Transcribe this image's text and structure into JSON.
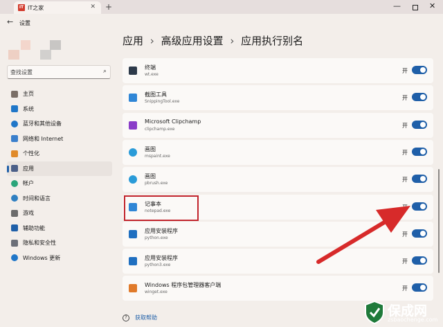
{
  "browser": {
    "tab_title": "IT之家",
    "favicon_text": "IT",
    "close_glyph": "✕",
    "new_tab_glyph": "+",
    "minimize_glyph": "—",
    "win_close_glyph": "✕"
  },
  "app": {
    "title": "设置",
    "back_glyph": "←"
  },
  "search": {
    "placeholder": "查找设置",
    "icon": "search-icon"
  },
  "sidebar": {
    "items": [
      {
        "label": "主页",
        "icon": "home-icon",
        "color": "#7a6e66",
        "active": false
      },
      {
        "label": "系统",
        "icon": "monitor-icon",
        "color": "#1f76c8",
        "active": false
      },
      {
        "label": "蓝牙和其他设备",
        "icon": "bluetooth-icon",
        "color": "#1f76c8",
        "active": false
      },
      {
        "label": "网络和 Internet",
        "icon": "wifi-icon",
        "color": "#3a7fcc",
        "active": false
      },
      {
        "label": "个性化",
        "icon": "brush-icon",
        "color": "#e08a2a",
        "active": false
      },
      {
        "label": "应用",
        "icon": "apps-icon",
        "color": "#4b5f88",
        "active": true
      },
      {
        "label": "帐户",
        "icon": "person-icon",
        "color": "#2aa57a",
        "active": false
      },
      {
        "label": "时间和语言",
        "icon": "clock-globe-icon",
        "color": "#2f7fc1",
        "active": false
      },
      {
        "label": "游戏",
        "icon": "gamepad-icon",
        "color": "#6b6b6b",
        "active": false
      },
      {
        "label": "辅助功能",
        "icon": "accessibility-icon",
        "color": "#1f5fa8",
        "active": false
      },
      {
        "label": "隐私和安全性",
        "icon": "shield-icon",
        "color": "#6b6f78",
        "active": false
      },
      {
        "label": "Windows 更新",
        "icon": "update-icon",
        "color": "#1f76c8",
        "active": false
      }
    ]
  },
  "breadcrumb": {
    "part1": "应用",
    "part2": "高级应用设置",
    "part3": "应用执行别名",
    "sep": "›"
  },
  "aliases": [
    {
      "name": "终端",
      "exe": "wt.exe",
      "state": "开",
      "icon": "terminal-icon",
      "color": "#2d3a4a"
    },
    {
      "name": "截图工具",
      "exe": "SnippingTool.exe",
      "state": "开",
      "icon": "snipping-tool-icon",
      "color": "#2f86d6"
    },
    {
      "name": "Microsoft Clipchamp",
      "exe": "clipchamp.exe",
      "state": "开",
      "icon": "clipchamp-icon",
      "color": "#8a3cc8"
    },
    {
      "name": "画图",
      "exe": "mspaint.exe",
      "state": "开",
      "icon": "paint-icon",
      "color": "#2a9bd8"
    },
    {
      "name": "画图",
      "exe": "pbrush.exe",
      "state": "开",
      "icon": "paint-icon",
      "color": "#2a9bd8"
    },
    {
      "name": "记事本",
      "exe": "notepad.exe",
      "state": "开",
      "icon": "notepad-icon",
      "color": "#2f86d6"
    },
    {
      "name": "应用安装程序",
      "exe": "python.exe",
      "state": "开",
      "icon": "app-installer-icon",
      "color": "#1f6fc0"
    },
    {
      "name": "应用安装程序",
      "exe": "python3.exe",
      "state": "开",
      "icon": "app-installer-icon",
      "color": "#1f6fc0"
    },
    {
      "name": "Windows 程序包管理器客户端",
      "exe": "winget.exe",
      "state": "开",
      "icon": "package-manager-icon",
      "color": "#e07a2a"
    }
  ],
  "help": {
    "label": "获取帮助",
    "icon": "help-icon",
    "glyph": "?"
  },
  "colors": {
    "accent": "#1f5fa8",
    "highlight": "#c1232b",
    "arrow": "#d72a2a"
  },
  "watermark": {
    "text": "保成网",
    "url": "zsbaochenge.com"
  }
}
